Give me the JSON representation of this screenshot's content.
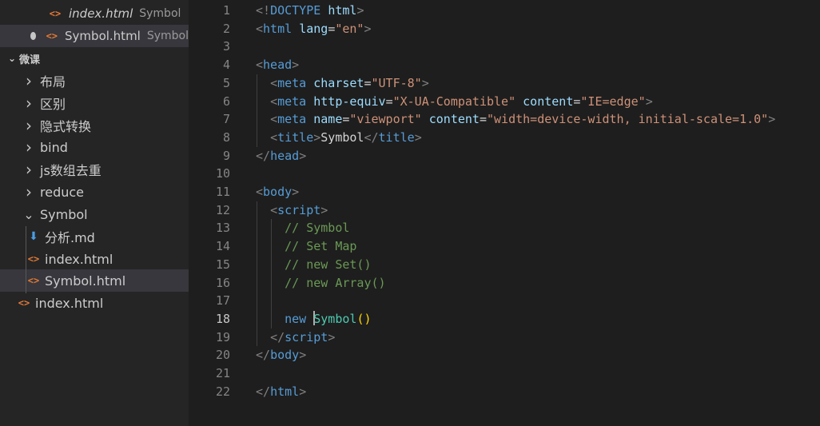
{
  "open_editors": [
    {
      "file": "index.html",
      "folder": "Symbol"
    },
    {
      "file": "Symbol.html",
      "folder": "Symbol",
      "dirty": true
    }
  ],
  "explorer": {
    "root": "微课",
    "items": [
      {
        "label": "布局",
        "type": "folder"
      },
      {
        "label": "区别",
        "type": "folder"
      },
      {
        "label": "隐式转换",
        "type": "folder"
      },
      {
        "label": "bind",
        "type": "folder"
      },
      {
        "label": "js数组去重",
        "type": "folder"
      },
      {
        "label": "reduce",
        "type": "folder"
      },
      {
        "label": "Symbol",
        "type": "folder-open"
      },
      {
        "label": "分析.md",
        "type": "md"
      },
      {
        "label": "index.html",
        "type": "html"
      },
      {
        "label": "Symbol.html",
        "type": "html"
      },
      {
        "label": "index.html",
        "type": "html"
      }
    ]
  },
  "editor": {
    "active_line": 18,
    "lines": [
      {
        "num": "1",
        "tokens": [
          [
            "t",
            "<!"
          ],
          [
            "n",
            "DOCTYPE"
          ],
          [
            "x",
            " "
          ],
          [
            "a",
            "html"
          ],
          [
            "t",
            ">"
          ]
        ]
      },
      {
        "num": "2",
        "tokens": [
          [
            "t",
            "<"
          ],
          [
            "n",
            "html"
          ],
          [
            "x",
            " "
          ],
          [
            "a",
            "lang"
          ],
          [
            "x",
            "="
          ],
          [
            "s",
            "\"en\""
          ],
          [
            "t",
            ">"
          ]
        ]
      },
      {
        "num": "3",
        "tokens": []
      },
      {
        "num": "4",
        "tokens": [
          [
            "t",
            "<"
          ],
          [
            "n",
            "head"
          ],
          [
            "t",
            ">"
          ]
        ]
      },
      {
        "num": "5",
        "tokens": [
          [
            "x",
            "  "
          ],
          [
            "t",
            "<"
          ],
          [
            "n",
            "meta"
          ],
          [
            "x",
            " "
          ],
          [
            "a",
            "charset"
          ],
          [
            "x",
            "="
          ],
          [
            "s",
            "\"UTF-8\""
          ],
          [
            "t",
            ">"
          ]
        ]
      },
      {
        "num": "6",
        "tokens": [
          [
            "x",
            "  "
          ],
          [
            "t",
            "<"
          ],
          [
            "n",
            "meta"
          ],
          [
            "x",
            " "
          ],
          [
            "a",
            "http-equiv"
          ],
          [
            "x",
            "="
          ],
          [
            "s",
            "\"X-UA-Compatible\""
          ],
          [
            "x",
            " "
          ],
          [
            "a",
            "content"
          ],
          [
            "x",
            "="
          ],
          [
            "s",
            "\"IE=edge\""
          ],
          [
            "t",
            ">"
          ]
        ]
      },
      {
        "num": "7",
        "tokens": [
          [
            "x",
            "  "
          ],
          [
            "t",
            "<"
          ],
          [
            "n",
            "meta"
          ],
          [
            "x",
            " "
          ],
          [
            "a",
            "name"
          ],
          [
            "x",
            "="
          ],
          [
            "s",
            "\"viewport\""
          ],
          [
            "x",
            " "
          ],
          [
            "a",
            "content"
          ],
          [
            "x",
            "="
          ],
          [
            "s",
            "\"width=device-width, initial-scale=1.0\""
          ],
          [
            "t",
            ">"
          ]
        ]
      },
      {
        "num": "8",
        "tokens": [
          [
            "x",
            "  "
          ],
          [
            "t",
            "<"
          ],
          [
            "n",
            "title"
          ],
          [
            "t",
            ">"
          ],
          [
            "x",
            "Symbol"
          ],
          [
            "t",
            "</"
          ],
          [
            "n",
            "title"
          ],
          [
            "t",
            ">"
          ]
        ]
      },
      {
        "num": "9",
        "tokens": [
          [
            "t",
            "</"
          ],
          [
            "n",
            "head"
          ],
          [
            "t",
            ">"
          ]
        ]
      },
      {
        "num": "10",
        "tokens": []
      },
      {
        "num": "11",
        "tokens": [
          [
            "t",
            "<"
          ],
          [
            "n",
            "body"
          ],
          [
            "t",
            ">"
          ]
        ]
      },
      {
        "num": "12",
        "tokens": [
          [
            "x",
            "  "
          ],
          [
            "t",
            "<"
          ],
          [
            "n",
            "script"
          ],
          [
            "t",
            ">"
          ]
        ]
      },
      {
        "num": "13",
        "tokens": [
          [
            "x",
            "    "
          ],
          [
            "c",
            "// Symbol"
          ]
        ]
      },
      {
        "num": "14",
        "tokens": [
          [
            "x",
            "    "
          ],
          [
            "c",
            "// Set Map"
          ]
        ]
      },
      {
        "num": "15",
        "tokens": [
          [
            "x",
            "    "
          ],
          [
            "c",
            "// new Set()"
          ]
        ]
      },
      {
        "num": "16",
        "tokens": [
          [
            "x",
            "    "
          ],
          [
            "c",
            "// new Array()"
          ]
        ]
      },
      {
        "num": "17",
        "tokens": []
      },
      {
        "num": "18",
        "tokens": [
          [
            "x",
            "    "
          ],
          [
            "k",
            "new"
          ],
          [
            "x",
            " "
          ],
          [
            "cursor",
            ""
          ],
          [
            "y",
            "Symbol"
          ],
          [
            "p",
            "()"
          ]
        ]
      },
      {
        "num": "19",
        "tokens": [
          [
            "x",
            "  "
          ],
          [
            "t",
            "</"
          ],
          [
            "n",
            "script"
          ],
          [
            "t",
            ">"
          ]
        ]
      },
      {
        "num": "20",
        "tokens": [
          [
            "t",
            "</"
          ],
          [
            "n",
            "body"
          ],
          [
            "t",
            ">"
          ]
        ]
      },
      {
        "num": "21",
        "tokens": []
      },
      {
        "num": "22",
        "tokens": [
          [
            "t",
            "</"
          ],
          [
            "n",
            "html"
          ],
          [
            "t",
            ">"
          ]
        ]
      }
    ]
  }
}
